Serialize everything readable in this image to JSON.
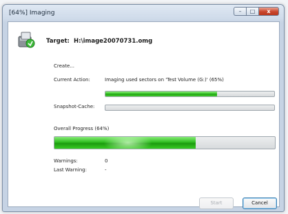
{
  "window": {
    "title": "[64%] Imaging"
  },
  "title_controls": {
    "minimize": "–",
    "maximize": "□",
    "close": "x"
  },
  "header": {
    "icon": "disk-image-icon",
    "target_label": "Target:",
    "target_value": "H:\\image20070731.omg"
  },
  "status": {
    "state_text": "Create...",
    "current_action_label": "Current Action:",
    "current_action_value": "Imaging used sectors on 'Test Volume (G:)' (65%)",
    "current_action_progress": 0.66,
    "snapshot_cache_label": "Snapshot-Cache:",
    "snapshot_cache_progress": 0
  },
  "overall": {
    "label": "Overall Progress (64%)",
    "progress": 0.64
  },
  "warnings": {
    "warnings_label": "Warnings:",
    "warnings_value": "0",
    "last_warning_label": "Last Warning:",
    "last_warning_value": "-"
  },
  "buttons": {
    "start": "Start",
    "cancel": "Cancel"
  },
  "colors": {
    "progress_green": "#2fbd20",
    "title_bar": "#cfdbea",
    "close_button": "#c9452b"
  }
}
